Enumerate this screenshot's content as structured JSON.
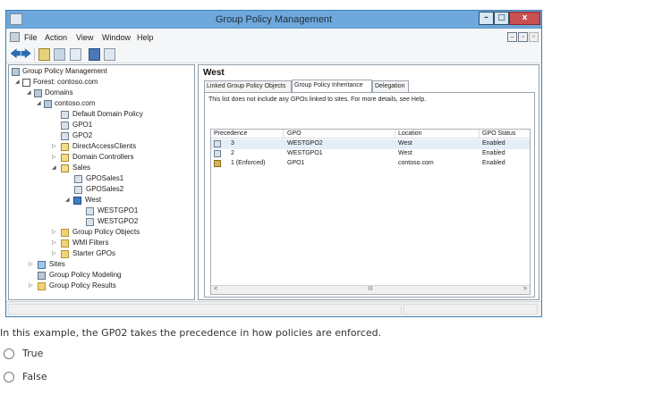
{
  "window": {
    "title": "Group Policy Management",
    "controls": {
      "minimize": "–",
      "maximize": "□",
      "close": "x"
    }
  },
  "menubar": {
    "items": [
      "File",
      "Action",
      "View",
      "Window",
      "Help"
    ],
    "mdi_controls": [
      "–",
      "▫",
      "×"
    ]
  },
  "toolbar": {
    "back": "🡄",
    "forward": "🡆"
  },
  "tree": {
    "items": [
      {
        "label": "Group Policy Management",
        "icon": "gpm-icon"
      },
      {
        "label": "Forest: contoso.com",
        "icon": "forest-icon",
        "expander": "◢"
      },
      {
        "label": "Domains",
        "icon": "domains-icon",
        "expander": "◢"
      },
      {
        "label": "contoso.com",
        "icon": "domain-icon",
        "expander": "◢"
      },
      {
        "label": "Default Domain Policy",
        "icon": "gpo-link-icon"
      },
      {
        "label": "GPO1",
        "icon": "gpo-link-icon"
      },
      {
        "label": "GPO2",
        "icon": "gpo-link-icon"
      },
      {
        "label": "DirectAccessClients",
        "icon": "ou-icon",
        "expander": "▷"
      },
      {
        "label": "Domain Controllers",
        "icon": "ou-icon",
        "expander": "▷"
      },
      {
        "label": "Sales",
        "icon": "ou-icon",
        "expander": "◢"
      },
      {
        "label": "GPOSales1",
        "icon": "gpo-link-icon"
      },
      {
        "label": "GPOSales2",
        "icon": "gpo-link-icon"
      },
      {
        "label": "West",
        "icon": "site-west-icon",
        "expander": "◢"
      },
      {
        "label": "WESTGPO1",
        "icon": "gpo-link-icon"
      },
      {
        "label": "WESTGPO2",
        "icon": "gpo-link-icon"
      },
      {
        "label": "Group Policy Objects",
        "icon": "folder-icon",
        "expander": "▷"
      },
      {
        "label": "WMI Filters",
        "icon": "folder-icon",
        "expander": "▷"
      },
      {
        "label": "Starter GPOs",
        "icon": "folder-icon",
        "expander": "▷"
      },
      {
        "label": "Sites",
        "icon": "sites-icon",
        "expander": "▷"
      },
      {
        "label": "Group Policy Modeling",
        "icon": "modeling-icon"
      },
      {
        "label": "Group Policy Results",
        "icon": "results-icon",
        "expander": "▷"
      }
    ]
  },
  "right": {
    "heading": "West",
    "tabs": [
      "Linked Group Policy Objects",
      "Group Policy Inheritance",
      "Delegation"
    ],
    "active_tab": "Group Policy Inheritance",
    "info": "This list does not include any GPOs linked to sites. For more details, see Help.",
    "table": {
      "columns": [
        "Precedence",
        "GPO",
        "Location",
        "GPO Status"
      ],
      "rows": [
        {
          "precedence": "3",
          "gpo": "WESTGPO2",
          "location": "West",
          "status": "Enabled"
        },
        {
          "precedence": "2",
          "gpo": "WESTGPO1",
          "location": "West",
          "status": "Enabled"
        },
        {
          "precedence": "1 (Enforced)",
          "gpo": "GPO1",
          "location": "contoso.com",
          "status": "Enabled"
        }
      ]
    },
    "scroll": {
      "left": "<",
      "right": ">",
      "thumb": "III"
    }
  },
  "question": {
    "text": "In this example, the GP02 takes the precedence in how policies are enforced.",
    "options": [
      "True",
      "False"
    ]
  }
}
